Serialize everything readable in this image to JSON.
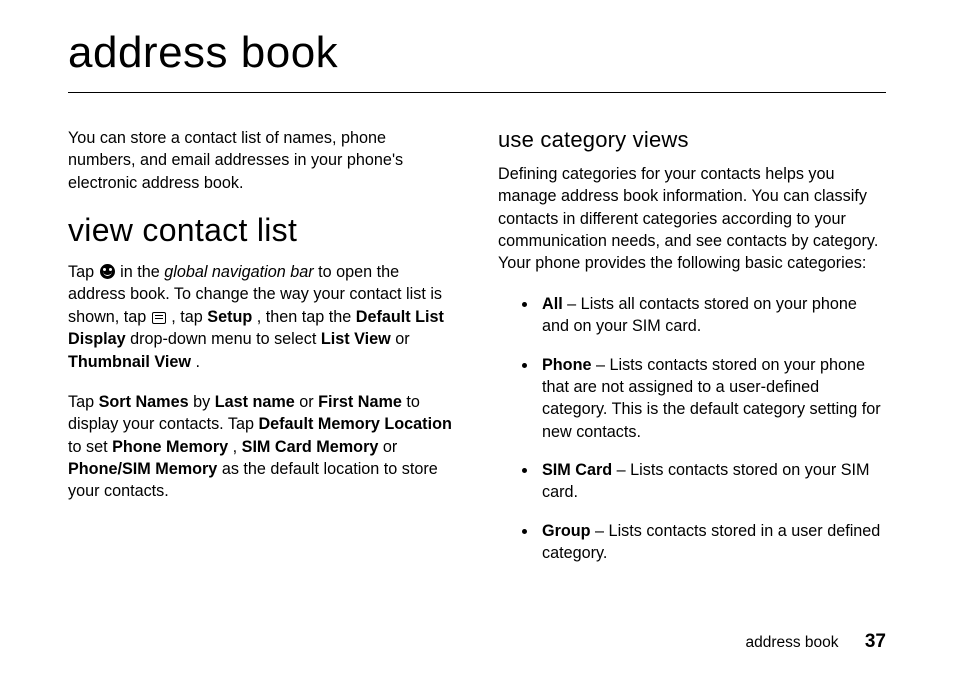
{
  "title": "address book",
  "intro": "You can store a contact list of names, phone numbers, and email addresses in your phone's electronic address book.",
  "left": {
    "heading": "view contact list",
    "p1": {
      "t1": "Tap ",
      "t2": " in the ",
      "global_nav": "global navigation bar",
      "t3": " to open the address book. To change the way your contact list is shown, tap ",
      "t4": " , tap ",
      "setup": "Setup",
      "t5": ", then tap the ",
      "dld": "Default List Display",
      "t6": " drop-down menu to select ",
      "listview": "List View",
      "or1": " or ",
      "thumbview": "Thumbnail View",
      "t7": "."
    },
    "p2": {
      "t1": "Tap ",
      "sortnames": "Sort Names",
      "t2": " by ",
      "lastname": "Last name",
      "or1": " or ",
      "firstname": "First Name",
      "t3": " to display your contacts. Tap ",
      "dml": "Default Memory Location",
      "t4": " to set ",
      "phonemem": "Phone Memory",
      "c1": ", ",
      "simmem": "SIM Card Memory",
      "or2": " or ",
      "psmem": "Phone/SIM Memory",
      "t5": " as the default location to store your contacts."
    }
  },
  "right": {
    "heading": "use category views",
    "intro": "Defining categories for your contacts helps you manage address book information. You can classify contacts in different categories according to your communication needs, and see contacts by category. Your phone provides the following basic categories:",
    "items": [
      {
        "name": "All",
        "desc": " – Lists all contacts stored on your phone and on your SIM card."
      },
      {
        "name": "Phone",
        "desc": " – Lists contacts stored on your phone that are not assigned to a user-defined category. This is the default category setting for new contacts."
      },
      {
        "name": "SIM Card",
        "desc": " – Lists contacts stored on your SIM card."
      },
      {
        "name": "Group",
        "desc": " – Lists contacts stored in a user defined category."
      }
    ]
  },
  "footer": {
    "label": "address book",
    "page": "37"
  }
}
